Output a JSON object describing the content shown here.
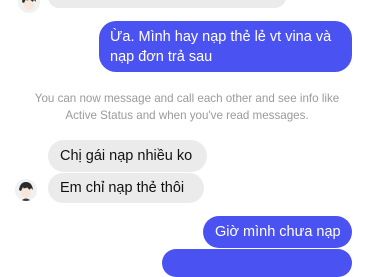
{
  "conversation": {
    "top_incoming_partial": "",
    "out_message_1": [
      "Ừa. Mình hay nạp thẻ lẻ vt vina và",
      "nạp đơn trả sau"
    ],
    "system_notice": [
      "You can now message and call each other and see info like",
      "Active Status and when you've read messages."
    ],
    "in_message_1": "Chị gái nạp nhiều ko",
    "in_message_2": "Em chỉ nạp thẻ thôi",
    "out_message_2": "Giờ mình chưa nạp",
    "out_message_3_partial": ""
  },
  "colors": {
    "outgoing_bubble": "#4a52f2",
    "incoming_bubble": "#ebebeb",
    "system_text": "#9a9a9a"
  },
  "icons": {
    "contact_avatar": "anime-boy-avatar-icon"
  }
}
